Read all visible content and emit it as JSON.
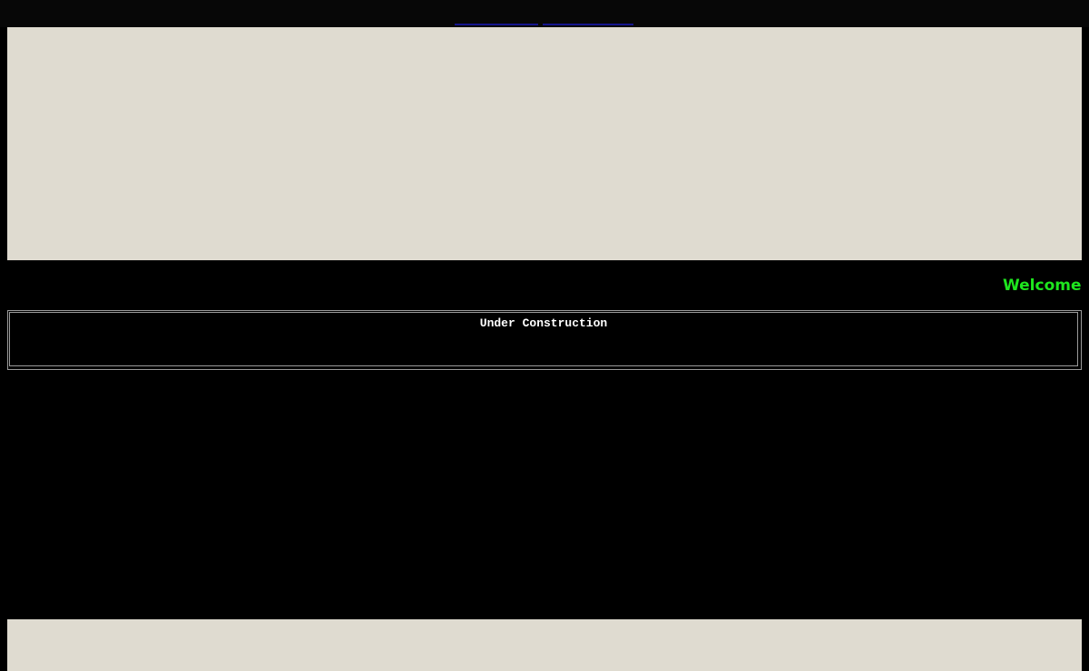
{
  "nav": {
    "links": [
      "",
      ""
    ]
  },
  "marquee": {
    "text": "Welcome t"
  },
  "notice": {
    "text": "Under Construction"
  },
  "colors": {
    "background": "#000000",
    "banner": "#dfdbd0",
    "welcome_text": "#1ee61e",
    "notice_text": "#ffffff",
    "link": "#14148c"
  }
}
